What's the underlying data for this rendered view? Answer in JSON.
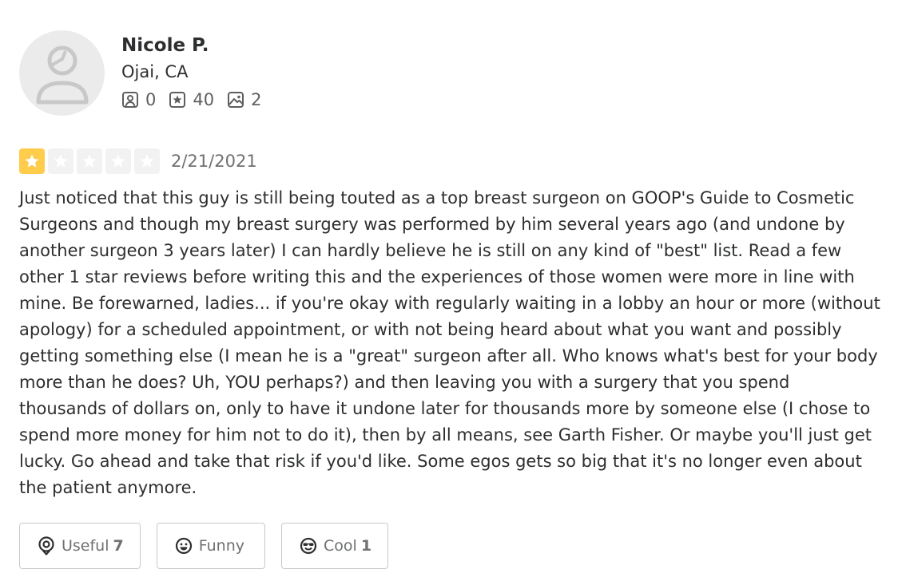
{
  "user": {
    "name": "Nicole P.",
    "location": "Ojai, CA",
    "stats": {
      "friends": "0",
      "reviews": "40",
      "photos": "2"
    },
    "avatar_icon": "default-avatar-icon"
  },
  "review": {
    "rating": 1,
    "rating_max": 5,
    "star_color": "#ffcc4b",
    "date": "2/21/2021",
    "text": "Just noticed that this guy is still being touted as a top breast surgeon on GOOP's Guide to Cosmetic Surgeons and though my breast surgery was performed by him several years ago (and undone by another surgeon 3 years later) I can hardly believe he is still on any kind of \"best\" list. Read a few other 1 star reviews before writing this and the experiences of those women were more in line with mine. Be forewarned, ladies... if you're okay with regularly waiting in a lobby an hour or more (without apology) for a scheduled appointment, or with not being heard about what you want and possibly getting something else (I mean he is a \"great\" surgeon after all. Who knows what's best for your body more than he does? Uh, YOU perhaps?) and then leaving you with a surgery that you spend thousands of dollars on, only to have it undone later for thousands more by someone else (I chose to spend more money for him not to do it), then by all means, see Garth Fisher. Or maybe you'll just get lucky. Go ahead and take that risk if you'd like. Some egos gets so big that it's no longer even about the patient anymore."
  },
  "reactions": {
    "useful": {
      "label": "Useful",
      "count": "7",
      "icon": "lightbulb-icon"
    },
    "funny": {
      "label": "Funny",
      "count": "",
      "icon": "smile-icon"
    },
    "cool": {
      "label": "Cool",
      "count": "1",
      "icon": "sunglasses-icon"
    }
  }
}
